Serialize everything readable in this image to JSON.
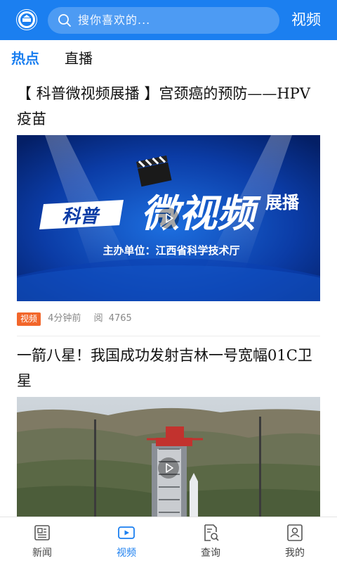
{
  "header": {
    "logo_icon": "emblem-logo",
    "search_placeholder": "搜你喜欢的...",
    "title": "视频"
  },
  "tabs": [
    {
      "label": "热点",
      "active": true
    },
    {
      "label": "直播",
      "active": false
    }
  ],
  "feed": [
    {
      "title": "【 科普微视频展播 】宫颈癌的预防——HPV疫苗",
      "banner": {
        "headline_left": "科普",
        "headline_main": "微视频",
        "headline_right": "展播",
        "organizer": "主办单位：江西省科学技术厅"
      },
      "badge": "视频",
      "time": "4分钟前",
      "views_label": "阅",
      "views": "4765"
    },
    {
      "title": "一箭八星！我国成功发射吉林一号宽幅01C卫星"
    }
  ],
  "bottom_nav": [
    {
      "label": "新闻",
      "icon": "newspaper-icon",
      "active": false
    },
    {
      "label": "视频",
      "icon": "video-icon",
      "active": true
    },
    {
      "label": "查询",
      "icon": "search-doc-icon",
      "active": false
    },
    {
      "label": "我的",
      "icon": "profile-icon",
      "active": false
    }
  ],
  "colors": {
    "brand": "#1b7ff0",
    "badge": "#f2662a"
  }
}
